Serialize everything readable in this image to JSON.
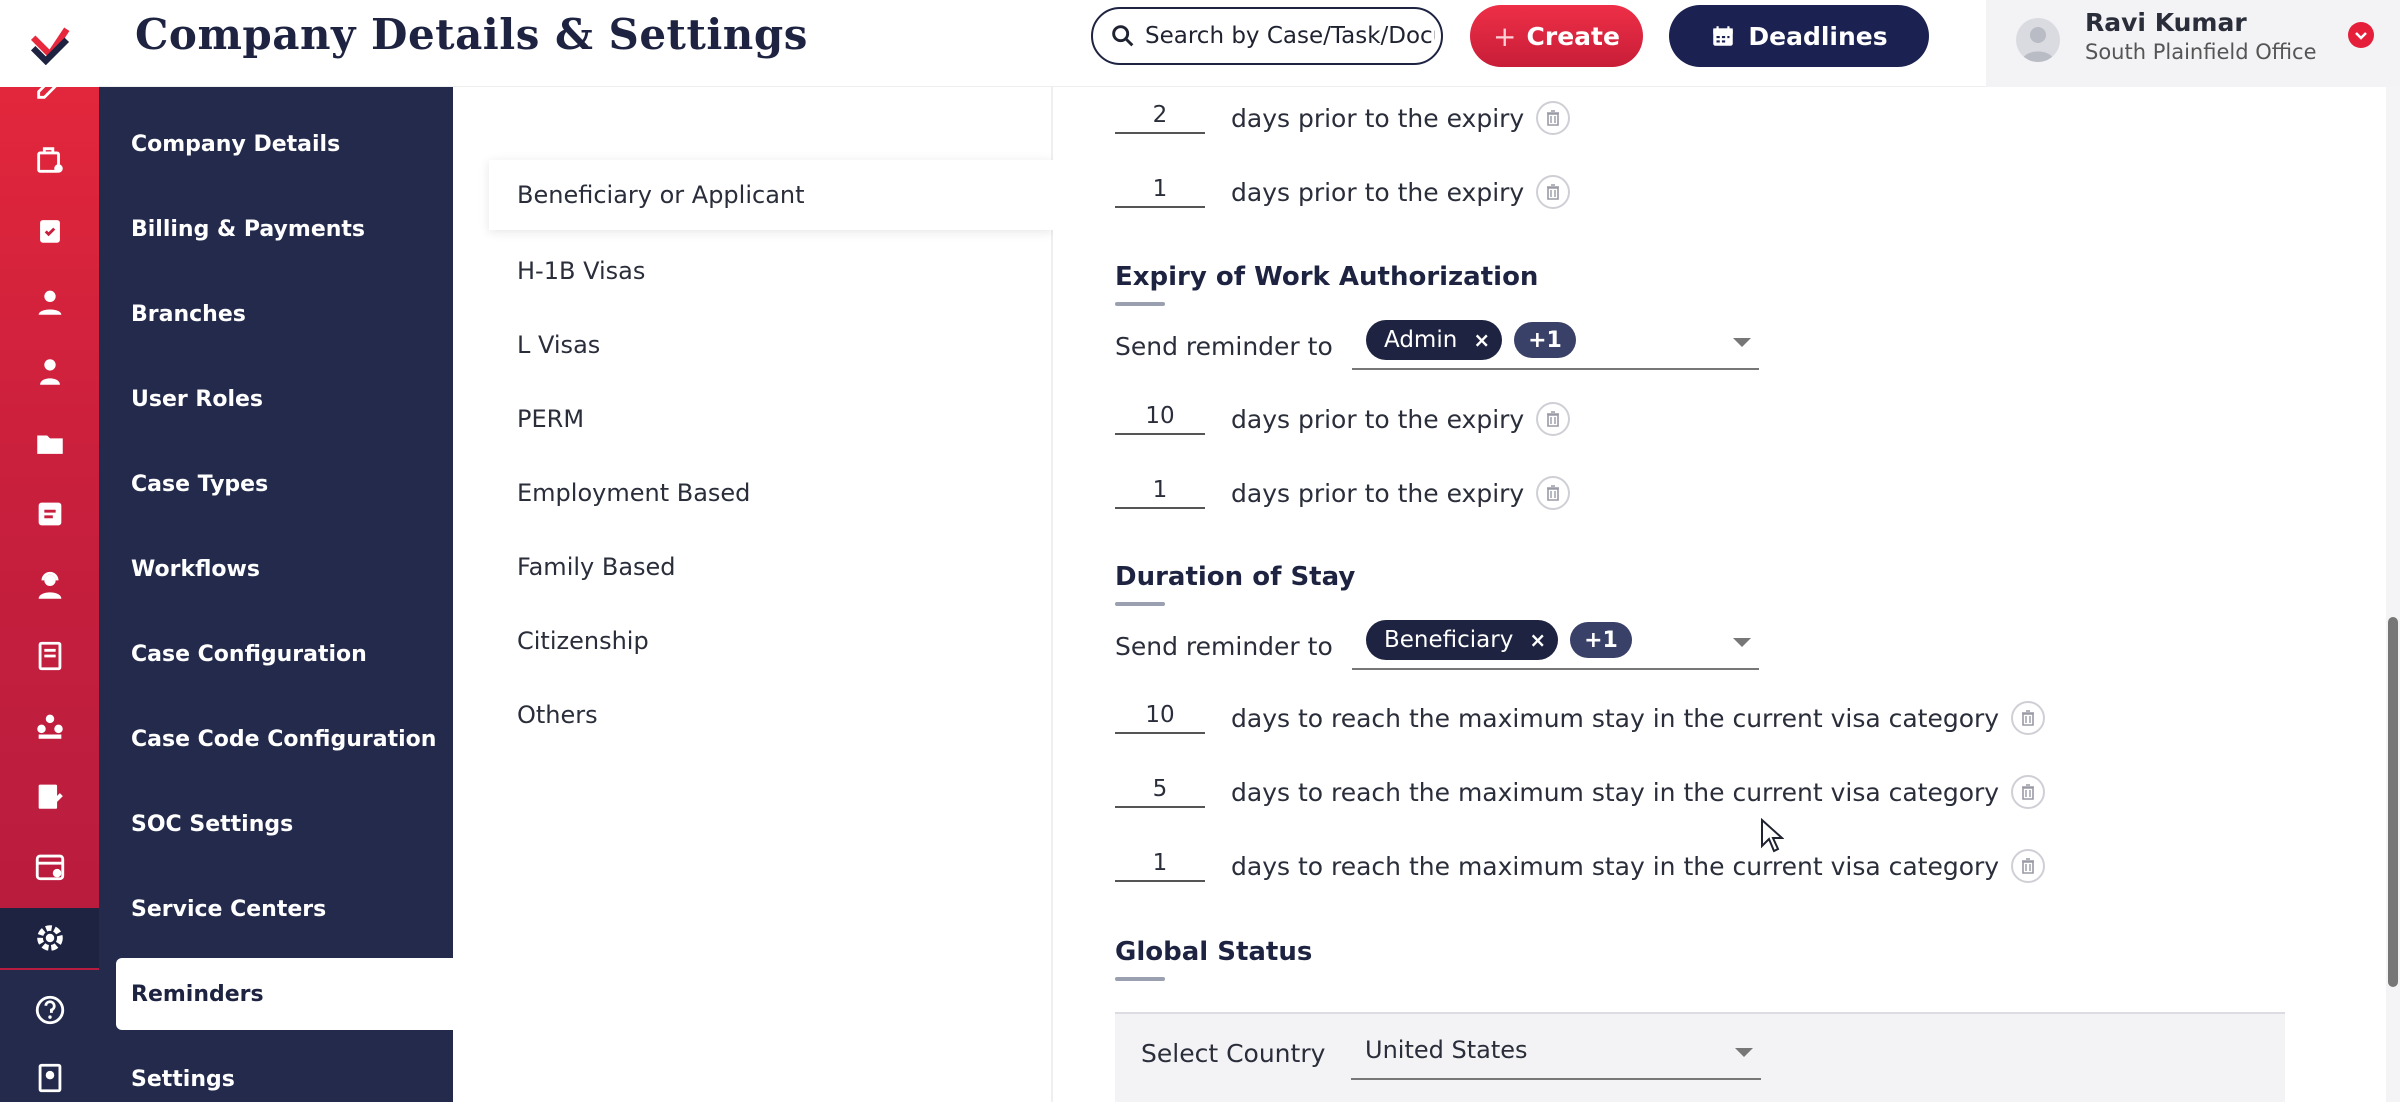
{
  "header": {
    "title": "Company Details & Settings",
    "search_placeholder": "Search by Case/Task/Document",
    "create_label": "Create",
    "deadlines_label": "Deadlines",
    "user_name": "Ravi Kumar",
    "user_office": "South Plainfield Office"
  },
  "sidebar": {
    "items": [
      {
        "label": "Company Details"
      },
      {
        "label": "Billing & Payments"
      },
      {
        "label": "Branches"
      },
      {
        "label": "User Roles"
      },
      {
        "label": "Case Types"
      },
      {
        "label": "Workflows"
      },
      {
        "label": "Case Configuration"
      },
      {
        "label": "Case Code Configuration"
      },
      {
        "label": "SOC Settings"
      },
      {
        "label": "Service Centers"
      },
      {
        "label": "Reminders"
      },
      {
        "label": "Settings"
      }
    ],
    "active": "Reminders"
  },
  "subnav": {
    "items": [
      {
        "label": "Beneficiary or Applicant"
      },
      {
        "label": "H-1B Visas"
      },
      {
        "label": "L Visas"
      },
      {
        "label": "PERM"
      },
      {
        "label": "Employment Based"
      },
      {
        "label": "Family Based"
      },
      {
        "label": "Citizenship"
      },
      {
        "label": "Others"
      }
    ],
    "active": "Beneficiary or Applicant"
  },
  "content": {
    "top_rows": [
      {
        "days": "2",
        "text": "days prior to the expiry"
      },
      {
        "days": "1",
        "text": "days prior to the expiry"
      }
    ],
    "work_auth": {
      "title": "Expiry of Work Authorization",
      "send_label": "Send reminder to",
      "chip": "Admin",
      "chip_more": "+1",
      "rows": [
        {
          "days": "10",
          "text": "days prior to the expiry"
        },
        {
          "days": "1",
          "text": "days prior to the expiry"
        }
      ]
    },
    "duration": {
      "title": "Duration of Stay",
      "send_label": "Send reminder to",
      "chip": "Beneficiary",
      "chip_more": "+1",
      "rows": [
        {
          "days": "10",
          "text": "days to reach the maximum stay in the current visa category"
        },
        {
          "days": "5",
          "text": "days to reach the maximum stay in the current visa category"
        },
        {
          "days": "1",
          "text": "days to reach the maximum stay in the current visa category"
        }
      ]
    },
    "global": {
      "title": "Global Status",
      "country_label": "Select Country",
      "country_value": "United States"
    }
  },
  "colors": {
    "brand_red": "#e8283c",
    "navy": "#1d2340",
    "sidebar": "#232a4c"
  },
  "icons": {
    "rail": [
      "edit-icon",
      "briefcase-icon",
      "clipboard-icon",
      "user-icon",
      "person-icon",
      "folder-icon",
      "note-icon",
      "agent-icon",
      "book-icon",
      "team-icon",
      "form-icon",
      "calendar-icon",
      "gear-icon",
      "help-icon",
      "ledger-icon"
    ]
  }
}
